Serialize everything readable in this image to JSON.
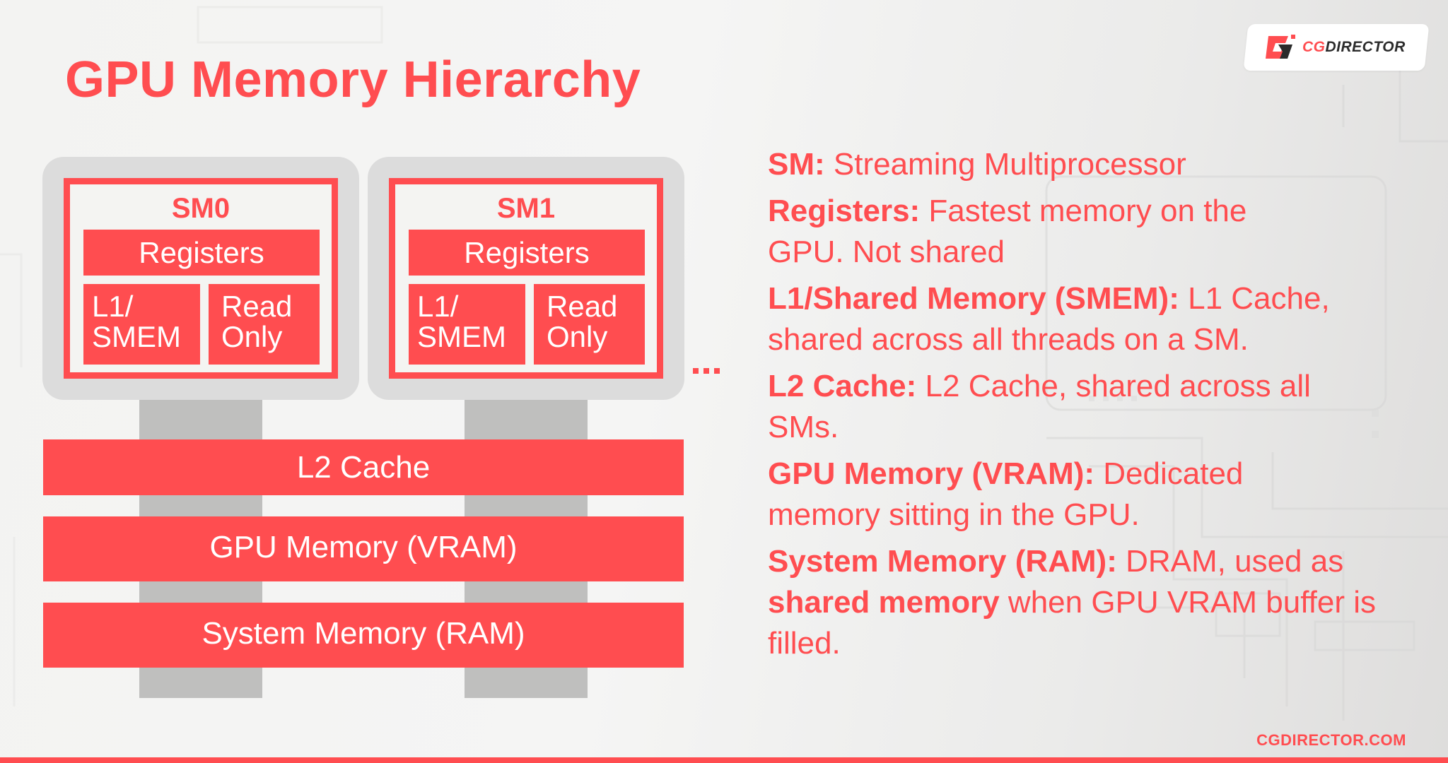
{
  "title": "GPU Memory Hierarchy",
  "logo": {
    "brand_prefix": "CG",
    "brand_suffix": "DIRECTOR",
    "icon": "cgdirector-logo-icon"
  },
  "colors": {
    "accent": "#ff4d50",
    "card_gray": "#dcdcdc",
    "connector_gray": "#bfbfbe",
    "text_on_accent": "#ffffff"
  },
  "diagram": {
    "sms": [
      {
        "label": "SM0",
        "registers": "Registers",
        "l1": [
          "L1/",
          "SMEM"
        ],
        "readonly": [
          "Read",
          "Only"
        ]
      },
      {
        "label": "SM1",
        "registers": "Registers",
        "l1": [
          "L1/",
          "SMEM"
        ],
        "readonly": [
          "Read",
          "Only"
        ]
      }
    ],
    "more_indicator": "...",
    "levels": [
      {
        "label": "L2 Cache"
      },
      {
        "label": "GPU Memory (VRAM)"
      },
      {
        "label": "System Memory (RAM)"
      }
    ]
  },
  "descriptions": [
    {
      "term": "SM:",
      "text": " Streaming Multiprocessor"
    },
    {
      "term": "Registers:",
      "text": " Fastest memory on the GPU. Not shared"
    },
    {
      "term": "L1/Shared Memory (SMEM):",
      "text": " L1 Cache, shared across all threads on a SM."
    },
    {
      "term": "L2 Cache:",
      "text": " L2 Cache, shared across all SMs."
    },
    {
      "term": "GPU Memory (VRAM):",
      "text": " Dedicated memory sitting in the GPU."
    },
    {
      "term": "System Memory (RAM):",
      "text_before": " DRAM, used as ",
      "emphasis": "shared memory",
      "text_after": " when GPU VRAM buffer is filled."
    }
  ],
  "footer": {
    "url": "CGDIRECTOR.COM"
  }
}
